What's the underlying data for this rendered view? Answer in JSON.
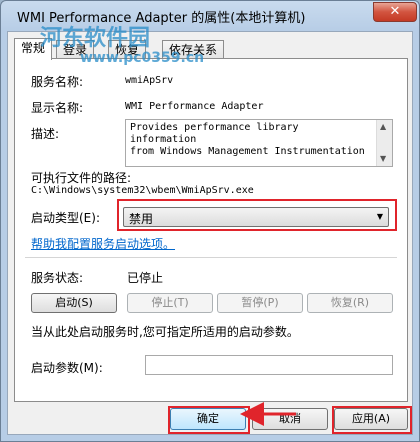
{
  "window": {
    "title": "WMI Performance Adapter 的属性(本地计算机)",
    "close_glyph": "✕"
  },
  "watermark": {
    "main": "河东软件园",
    "url": "www.pc0359.cn"
  },
  "tabs": [
    {
      "label": "常规",
      "active": true
    },
    {
      "label": "登录",
      "active": false
    },
    {
      "label": "恢复",
      "active": false
    },
    {
      "label": "依存关系",
      "active": false
    }
  ],
  "general": {
    "service_name_label": "服务名称:",
    "service_name": "wmiApSrv",
    "display_name_label": "显示名称:",
    "display_name": "WMI Performance Adapter",
    "description_label": "描述:",
    "description_line1": "Provides performance library information",
    "description_line2": "from Windows Management Instrumentation",
    "exe_path_label": "可执行文件的路径:",
    "exe_path": "C:\\Windows\\system32\\wbem\\WmiApSrv.exe",
    "startup_type_label": "启动类型(E):",
    "startup_type_value": "禁用",
    "help_link": "帮助我配置服务启动选项。",
    "status_label": "服务状态:",
    "status_value": "已停止",
    "start_btn": "启动(S)",
    "stop_btn": "停止(T)",
    "pause_btn": "暂停(P)",
    "resume_btn": "恢复(R)",
    "hint": "当从此处启动服务时,您可指定所适用的启动参数。",
    "params_label": "启动参数(M):",
    "params_value": ""
  },
  "footer": {
    "ok_label": "确定",
    "cancel_label": "取消",
    "apply_label": "应用(A)"
  },
  "colors": {
    "annotation_red": "#e0242b",
    "link_blue": "#0066cc"
  }
}
